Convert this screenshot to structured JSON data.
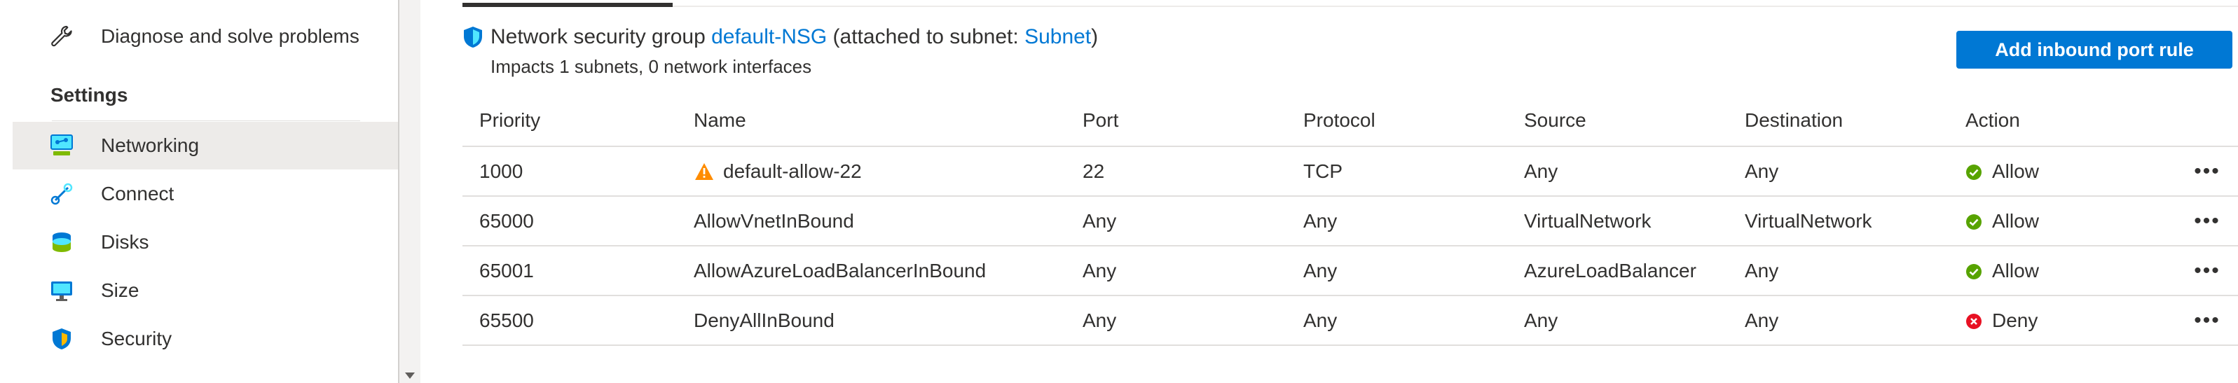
{
  "sidebar": {
    "items_top": [
      {
        "label": "Diagnose and solve problems",
        "icon": "wrench-icon"
      }
    ],
    "section_title": "Settings",
    "items": [
      {
        "label": "Networking",
        "icon": "networking-icon",
        "active": true
      },
      {
        "label": "Connect",
        "icon": "connect-icon"
      },
      {
        "label": "Disks",
        "icon": "disks-icon"
      },
      {
        "label": "Size",
        "icon": "size-monitor-icon"
      },
      {
        "label": "Security",
        "icon": "security-shield-icon"
      }
    ]
  },
  "nsg": {
    "prefix": "Network security group ",
    "name": "default-NSG",
    "attached_prefix": " (attached to subnet: ",
    "subnet": "Subnet",
    "attached_suffix": ")",
    "impacts": "Impacts 1 subnets, 0 network interfaces"
  },
  "toolbar": {
    "add_inbound_label": "Add inbound port rule"
  },
  "table": {
    "columns": {
      "priority": "Priority",
      "name": "Name",
      "port": "Port",
      "protocol": "Protocol",
      "source": "Source",
      "destination": "Destination",
      "action": "Action"
    },
    "rows": [
      {
        "priority": "1000",
        "name": "default-allow-22",
        "warning": true,
        "port": "22",
        "protocol": "TCP",
        "source": "Any",
        "destination": "Any",
        "action": "Allow",
        "more": "•••"
      },
      {
        "priority": "65000",
        "name": "AllowVnetInBound",
        "warning": false,
        "port": "Any",
        "protocol": "Any",
        "source": "VirtualNetwork",
        "destination": "VirtualNetwork",
        "action": "Allow",
        "more": "•••"
      },
      {
        "priority": "65001",
        "name": "AllowAzureLoadBalancerInBound",
        "warning": false,
        "port": "Any",
        "protocol": "Any",
        "source": "AzureLoadBalancer",
        "destination": "Any",
        "action": "Allow",
        "more": "•••"
      },
      {
        "priority": "65500",
        "name": "DenyAllInBound",
        "warning": false,
        "port": "Any",
        "protocol": "Any",
        "source": "Any",
        "destination": "Any",
        "action": "Deny",
        "more": "•••"
      }
    ]
  },
  "colors": {
    "accent": "#0078d4",
    "allow": "#57a300",
    "deny": "#e81123",
    "warning": "#ff8c00"
  }
}
